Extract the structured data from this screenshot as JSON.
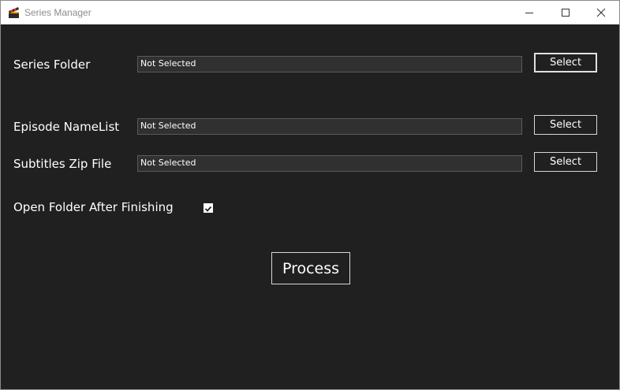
{
  "window": {
    "title": "Series Manager",
    "app_icon": "clapperboard-icon",
    "controls": [
      "minimize-icon",
      "maximize-icon",
      "close-icon"
    ]
  },
  "form": {
    "series_folder": {
      "label": "Series Folder",
      "value": "Not Selected",
      "button": "Select"
    },
    "episode_namelist": {
      "label": "Episode NameList",
      "value": "Not Selected",
      "button": "Select"
    },
    "subtitles_zip": {
      "label": "Subtitles Zip File",
      "value": "Not Selected",
      "button": "Select"
    },
    "open_folder": {
      "label": "Open Folder After Finishing",
      "checked": true
    },
    "process_button": "Process"
  },
  "colors": {
    "background": "#202020",
    "field_background": "#303030",
    "text": "#ffffff",
    "titlebar": "#ffffff"
  }
}
